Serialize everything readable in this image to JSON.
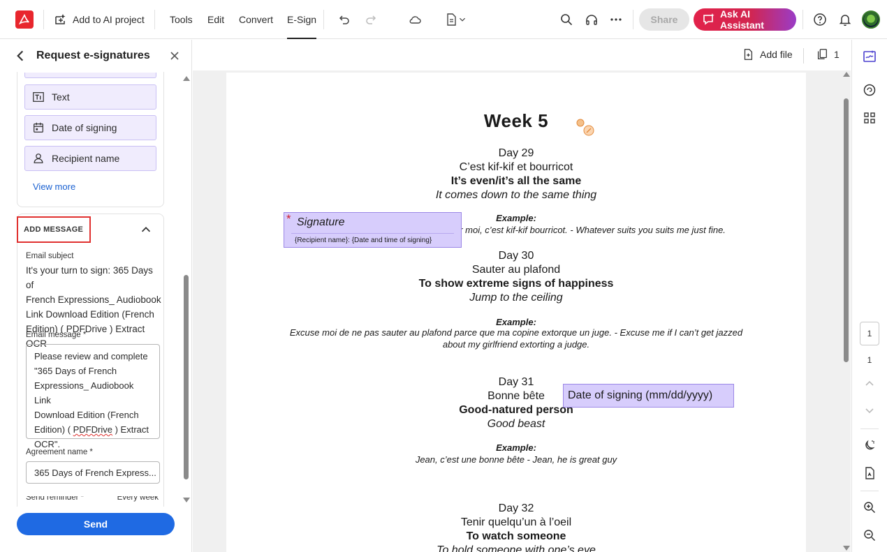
{
  "toolbar": {
    "add_ai_project": "Add to AI project",
    "tools": "Tools",
    "edit": "Edit",
    "convert": "Convert",
    "esign": "E-Sign",
    "share": "Share",
    "ask_ai": "Ask AI Assistant"
  },
  "panel": {
    "title": "Request e-signatures",
    "fields": [
      {
        "label": "Text",
        "icon": "text-field-icon"
      },
      {
        "label": "Date of signing",
        "icon": "calendar-icon"
      },
      {
        "label": "Recipient name",
        "icon": "person-icon"
      }
    ],
    "view_more": "View more",
    "add_message": "ADD MESSAGE",
    "email_subject_label": "Email subject",
    "email_subject_lines": [
      "It's your turn to sign: 365 Days of",
      "French Expressions_ Audiobook",
      "Link Download Edition (French",
      "Edition) ( PDFDrive ) Extract OCR"
    ],
    "email_message_label": "Email message",
    "email_message_lines": [
      "Please review and complete",
      "\"365 Days of French",
      "Expressions_ Audiobook Link",
      "Download Edition (French",
      "Edition) ( ",
      "PDFDrive",
      " ) Extract",
      "OCR\"."
    ],
    "agreement_label": "Agreement name",
    "agreement_value": "365 Days of French Express...",
    "reminder_label": "Send reminder",
    "reminder_value": "Every week",
    "required_mark": "*",
    "send": "Send"
  },
  "doc": {
    "add_file": "Add file",
    "page_count": "1",
    "heading": "Week 5",
    "days": [
      {
        "day": "Day 29",
        "fr": "C’est kif-kif et bourricot",
        "en": "It’s even/it’s all the same",
        "lit": "It comes down to the same thing",
        "ex_label": "Example:",
        "ex": [
          "Pour moi, c’est kif-kif bourricot. - Whatever suits you suits me just fine."
        ]
      },
      {
        "day": "Day 30",
        "fr": "Sauter au plafond",
        "en": "To show extreme signs of happiness",
        "lit": "Jump to the ceiling",
        "ex_label": "Example:",
        "ex": [
          "Excuse moi de ne pas sauter au plafond parce que ma copine extorque un juge. - Excuse me if I can’t get jazzed",
          "about my girlfriend extorting a judge."
        ]
      },
      {
        "day": "Day 31",
        "fr": "Bonne bête",
        "en": "Good-natured person",
        "lit": "Good beast",
        "ex_label": "Example:",
        "ex": [
          "Jean, c’est une bonne bête - Jean, he is great guy"
        ]
      },
      {
        "day": "Day 32",
        "fr": "Tenir quelqu’un à l’oeil",
        "en": "To watch someone",
        "lit": "To hold someone with one’s eye"
      }
    ],
    "sig_field": {
      "required": "*",
      "label": "Signature",
      "sub": "{Recipient name}: {Date and time of signing}"
    },
    "date_field": "Date of signing (mm/dd/yyyy)"
  },
  "rail": {
    "current_page": "1",
    "total_pages": "1"
  },
  "colors": {
    "accent_red": "#e8262d",
    "send_blue": "#1f6ae3",
    "field_fill": "#d7cdfc",
    "highlight_box": "#e0312f"
  }
}
